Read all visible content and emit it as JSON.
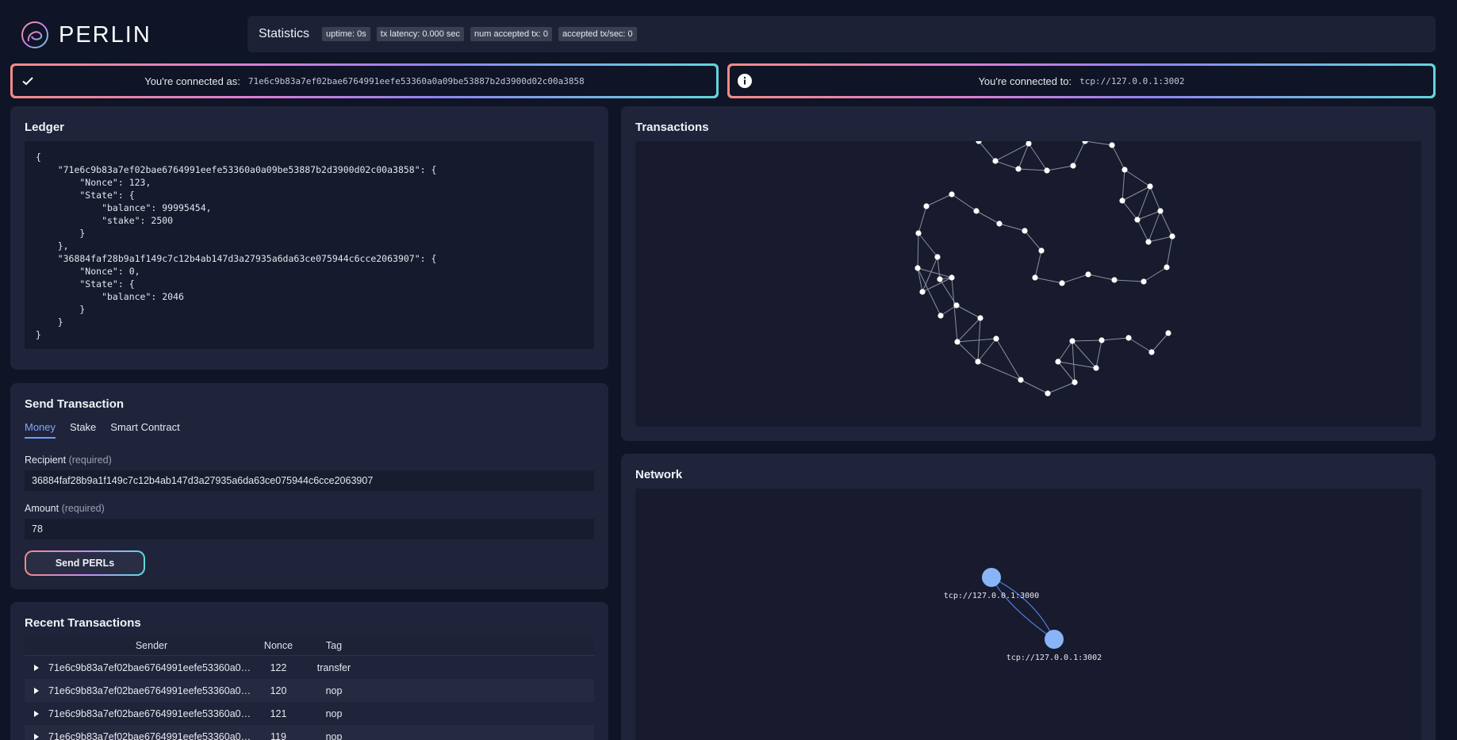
{
  "app": {
    "logo_text": "PERLIN"
  },
  "stats": {
    "title": "Statistics",
    "chips": [
      "uptime: 0s",
      "tx latency: 0.000 sec",
      "num accepted tx: 0",
      "accepted tx/sec: 0"
    ]
  },
  "connection": {
    "as_label": "You're connected as:",
    "as_value": "71e6c9b83a7ef02bae6764991eefe53360a0a09be53887b2d3900d02c00a3858",
    "to_label": "You're connected to:",
    "to_value": "tcp://127.0.0.1:3002"
  },
  "ledger": {
    "title": "Ledger",
    "content": "{\n    \"71e6c9b83a7ef02bae6764991eefe53360a0a09be53887b2d3900d02c00a3858\": {\n        \"Nonce\": 123,\n        \"State\": {\n            \"balance\": 99995454,\n            \"stake\": 2500\n        }\n    },\n    \"36884faf28b9a1f149c7c12b4ab147d3a27935a6da63ce075944c6cce2063907\": {\n        \"Nonce\": 0,\n        \"State\": {\n            \"balance\": 2046\n        }\n    }\n}"
  },
  "send": {
    "title": "Send Transaction",
    "tabs": [
      "Money",
      "Stake",
      "Smart Contract"
    ],
    "recipient_label": "Recipient",
    "recipient_req": "(required)",
    "recipient_value": "36884faf28b9a1f149c7c12b4ab147d3a27935a6da63ce075944c6cce2063907",
    "amount_label": "Amount",
    "amount_req": "(required)",
    "amount_value": "78",
    "button_label": "Send PERLs"
  },
  "recent": {
    "title": "Recent Transactions",
    "headers": [
      "Sender",
      "Nonce",
      "Tag"
    ],
    "rows": [
      {
        "sender": "71e6c9b83a7ef02bae6764991eefe53360a0…",
        "nonce": "122",
        "tag": "transfer"
      },
      {
        "sender": "71e6c9b83a7ef02bae6764991eefe53360a0…",
        "nonce": "120",
        "tag": "nop"
      },
      {
        "sender": "71e6c9b83a7ef02bae6764991eefe53360a0…",
        "nonce": "121",
        "tag": "nop"
      },
      {
        "sender": "71e6c9b83a7ef02bae6764991eefe53360a0…",
        "nonce": "119",
        "tag": "nop"
      }
    ]
  },
  "transactions": {
    "title": "Transactions"
  },
  "network": {
    "title": "Network",
    "nodes": [
      "tcp://127.0.0.1:3000",
      "tcp://127.0.0.1:3002"
    ]
  },
  "colors": {
    "accent": "#6f9dff",
    "node_fill": "#8ab4f8",
    "panel": "#20243a",
    "background": "#0f1426"
  }
}
